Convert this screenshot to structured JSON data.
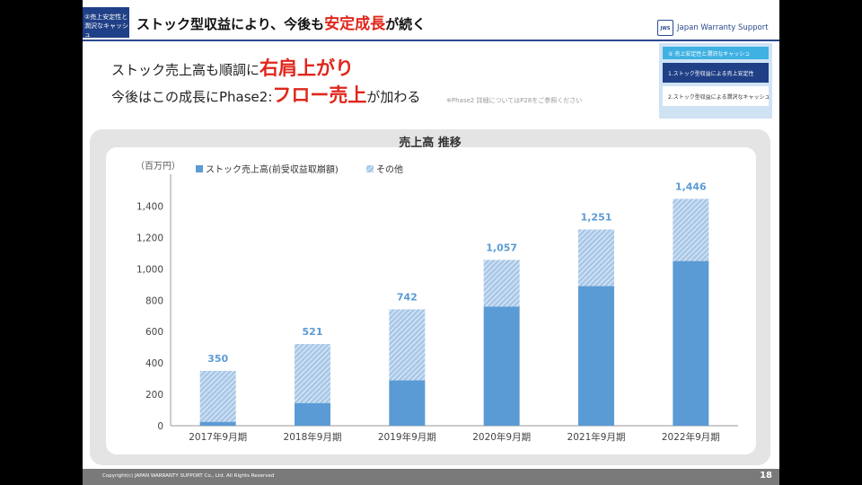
{
  "header": {
    "section_tag": "②売上安定性と潤沢なキャッシュ",
    "title_prefix": "ストック型収益により、今後も",
    "title_strong": "安定成長",
    "title_suffix": "が続く"
  },
  "logo": {
    "text": "Japan Warranty Support",
    "mark": "JWS"
  },
  "nav": {
    "items": [
      {
        "label": "② 売上安定性と潤沢なキャッシュ"
      },
      {
        "label": "1.ストック型収益による売上安定性"
      },
      {
        "label": "2.ストック型収益による潤沢なキャッシュ"
      }
    ]
  },
  "lead": {
    "line1_prefix": "ストック売上高も順調に",
    "line1_hl": "右肩上がり",
    "line2_prefix": "今後はこの成長にPhase2:",
    "line2_hl": "フロー売上",
    "line2_suffix": "が加わる",
    "note": "※Phase2 詳細についてはP28をご参照ください"
  },
  "chart_data": {
    "type": "bar",
    "title": "売上高 推移",
    "unit_label": "（百万円）",
    "categories": [
      "2017年9月期",
      "2018年9月期",
      "2019年9月期",
      "2020年9月期",
      "2021年9月期",
      "2022年9月期"
    ],
    "series": [
      {
        "name": "ストック売上高(前受収益取崩額)",
        "values": [
          25,
          145,
          290,
          760,
          890,
          1050
        ],
        "color": "#5b9bd5"
      },
      {
        "name": "その他",
        "values": [
          325,
          376,
          452,
          297,
          361,
          396
        ],
        "color": "#a9c8e8"
      }
    ],
    "totals": [
      "350",
      "521",
      "742",
      "1,057",
      "1,251",
      "1,446"
    ],
    "ylim": [
      0,
      1500
    ],
    "yticks": [
      0,
      200,
      400,
      600,
      800,
      1000,
      1200,
      1400
    ],
    "ytick_labels": [
      "0",
      "200",
      "400",
      "600",
      "800",
      "1,000",
      "1,200",
      "1,400"
    ],
    "legend_position": "top-left",
    "stacked": true
  },
  "footer": {
    "copyright": "Copyright(c) JAPAN WARRANTY SUPPORT Co., Ltd. All Rights Reserved",
    "page": "18"
  }
}
